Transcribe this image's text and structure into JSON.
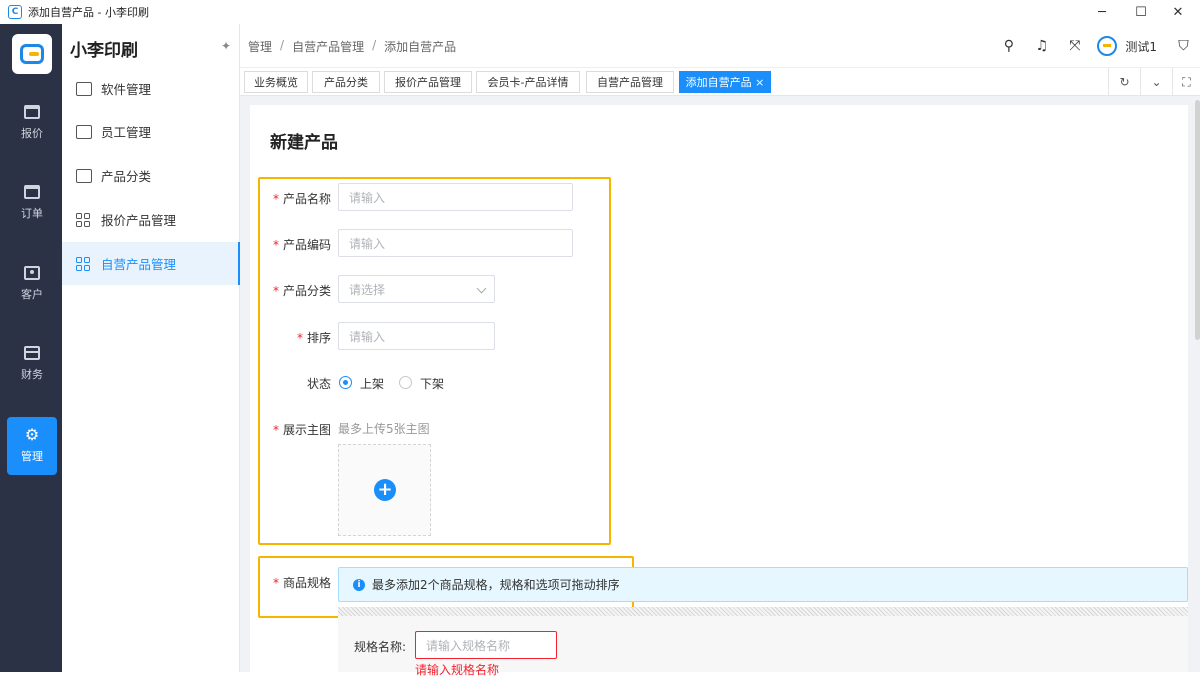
{
  "window": {
    "title": "添加自营产品 - 小李印刷",
    "controls": {
      "minimize": "─",
      "maximize": "☐",
      "close": "✕"
    }
  },
  "rail": {
    "items": [
      {
        "label": "报价",
        "icon": "calendar-icon"
      },
      {
        "label": "订单",
        "icon": "clipboard-icon"
      },
      {
        "label": "客户",
        "icon": "person-card-icon"
      },
      {
        "label": "财务",
        "icon": "wallet-icon"
      },
      {
        "label": "管理",
        "icon": "gear-icon",
        "active": true
      }
    ]
  },
  "sidebar": {
    "title": "小李印刷",
    "pin": "📌",
    "items": [
      {
        "label": "软件管理",
        "icon": "code-window-icon"
      },
      {
        "label": "员工管理",
        "icon": "id-card-icon"
      },
      {
        "label": "产品分类",
        "icon": "list-icon"
      },
      {
        "label": "报价产品管理",
        "icon": "grid-icon"
      },
      {
        "label": "自营产品管理",
        "icon": "grid-icon",
        "active": true
      }
    ]
  },
  "header": {
    "breadcrumb": [
      "管理",
      "自营产品管理",
      "添加自营产品"
    ],
    "separator": "/",
    "user_name": "测试1"
  },
  "tabs": [
    {
      "label": "业务概览"
    },
    {
      "label": "产品分类"
    },
    {
      "label": "报价产品管理"
    },
    {
      "label": "会员卡-产品详情"
    },
    {
      "label": "自营产品管理"
    },
    {
      "label": "添加自营产品 ×",
      "active": true
    }
  ],
  "form": {
    "title": "新建产品",
    "required_mark": "*",
    "fields": {
      "name": {
        "label": "产品名称",
        "placeholder": "请输入"
      },
      "code": {
        "label": "产品编码",
        "placeholder": "请输入"
      },
      "category": {
        "label": "产品分类",
        "placeholder": "请选择"
      },
      "sort": {
        "label": "排序",
        "placeholder": "请输入"
      },
      "status": {
        "label": "状态",
        "options": [
          "上架",
          "下架"
        ],
        "selected": "上架"
      },
      "images": {
        "label": "展示主图",
        "hint": "最多上传5张主图",
        "add": "+"
      }
    },
    "spec": {
      "label": "商品规格",
      "info_icon": "i",
      "info": "最多添加2个商品规格，规格和选项可拖动排序",
      "name_label": "规格名称:",
      "name_placeholder": "请输入规格名称",
      "error": "请输入规格名称"
    }
  },
  "colors": {
    "accent": "#1a8ffc",
    "rail_bg": "#2b3245",
    "highlight": "#f6b500",
    "error": "#f5222d"
  }
}
